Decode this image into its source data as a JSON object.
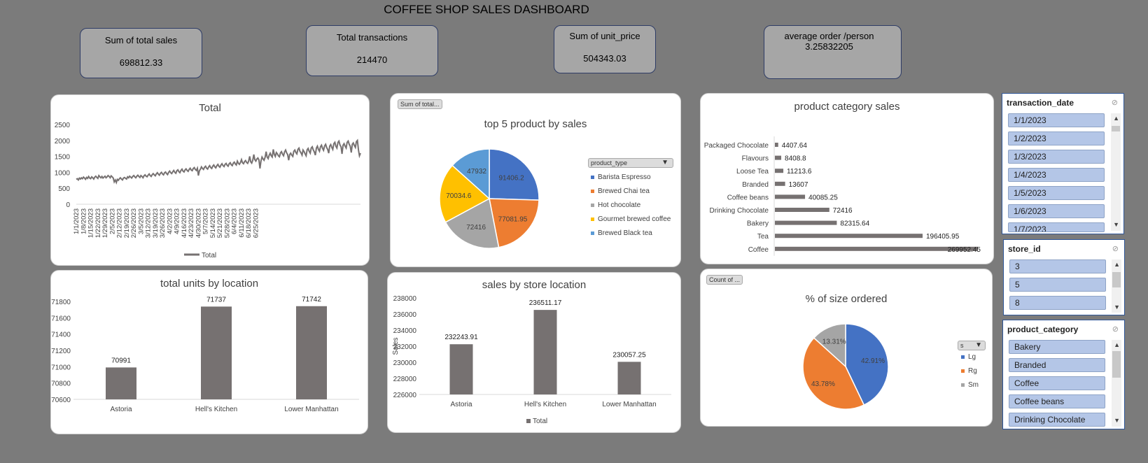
{
  "title": "COFFEE SHOP SALES DASHBOARD",
  "kpis": [
    {
      "label": "Sum of total sales",
      "value": "698812.33"
    },
    {
      "label": "Total transactions",
      "value": "214470"
    },
    {
      "label": "Sum of unit_price",
      "value": "504343.03"
    },
    {
      "label": "average order /person",
      "value": "3.25832205"
    }
  ],
  "colors": {
    "bar": "#767171",
    "line": "#767171",
    "blue": "#4472c4",
    "orange": "#ed7d31",
    "gray": "#a5a5a5",
    "yellow": "#ffc000",
    "lightblue": "#5b9bd5"
  },
  "chart_data": [
    {
      "type": "line",
      "title": "Total",
      "series": [
        {
          "name": "Total",
          "values": [
            780,
            800,
            760,
            820,
            790,
            830,
            800,
            850,
            820,
            780,
            840,
            810,
            870,
            820,
            800,
            860,
            830,
            790,
            850,
            880,
            840,
            810,
            900,
            860,
            830,
            870,
            820,
            850,
            880,
            830,
            860,
            900,
            870,
            830,
            890,
            860,
            820,
            700,
            760,
            680,
            780,
            750,
            800,
            830,
            790,
            760,
            820,
            840,
            810,
            790,
            860,
            830,
            880,
            850,
            820,
            870,
            900,
            860,
            830,
            880,
            910,
            870,
            840,
            900,
            870,
            830,
            890,
            920,
            880,
            860,
            910,
            950,
            900,
            870,
            930,
            960,
            920,
            890,
            950,
            990,
            940,
            910,
            970,
            1000,
            950,
            920,
            990,
            1010,
            960,
            930,
            1000,
            1040,
            990,
            960,
            1020,
            1060,
            1000,
            970,
            1050,
            1080,
            1020,
            990,
            1060,
            1100,
            1040,
            1010,
            1080,
            1110,
            1060,
            1030,
            1090,
            1130,
            1070,
            1050,
            1120,
            1150,
            1090,
            1060,
            1130,
            900,
            1050,
            1100,
            1170,
            1120,
            1090,
            1160,
            1190,
            1130,
            1100,
            1170,
            1210,
            1150,
            1120,
            1190,
            1230,
            1170,
            1140,
            1210,
            1250,
            1190,
            1160,
            1230,
            1270,
            1210,
            1180,
            1250,
            1280,
            1220,
            1190,
            1270,
            1300,
            1240,
            1210,
            1290,
            1320,
            1260,
            1230,
            1350,
            1280,
            1250,
            1310,
            1400,
            1300,
            1270,
            1340,
            1370,
            1310,
            1280,
            1350,
            1500,
            1330,
            1290,
            1380,
            1560,
            1400,
            1350,
            1420,
            1450,
            1390,
            1120,
            1350,
            1480,
            1420,
            1380,
            1470,
            1650,
            1480,
            1430,
            1540,
            1600,
            1520,
            1480,
            1720,
            1560,
            1500,
            1620,
            1580,
            1520,
            1490,
            1610,
            1650,
            1570,
            1520,
            1640,
            1700,
            1610,
            1560,
            1380,
            1560,
            1600,
            1540,
            1500,
            1660,
            1700,
            1620,
            1580,
            1720,
            1760,
            1660,
            1610,
            1540,
            1700,
            1650,
            1580,
            1520,
            1710,
            1750,
            1660,
            1600,
            1760,
            1800,
            1700,
            1640,
            1540,
            1760,
            1820,
            1720,
            1660,
            1800,
            1850,
            1750,
            1690,
            1830,
            1880,
            1780,
            1720,
            1600,
            1820,
            1870,
            1780,
            1720,
            1900,
            1940,
            1820,
            1760,
            1940,
            1980,
            1860,
            1800,
            1580,
            1850,
            1900,
            1820,
            1760,
            1940,
            1980,
            1880,
            1820,
            1620,
            1880,
            1920,
            1840,
            1780,
            1960,
            2000,
            1700,
            1520,
            1600
          ]
        }
      ],
      "x_ticks": [
        "1/1/2023",
        "1/8/2023",
        "1/15/2023",
        "1/22/2023",
        "1/29/2023",
        "2/5/2023",
        "2/12/2023",
        "2/19/2023",
        "2/26/2023",
        "3/5/2023",
        "3/12/2023",
        "3/19/2023",
        "3/26/2023",
        "4/2/2023",
        "4/9/2023",
        "4/16/2023",
        "4/23/2023",
        "4/30/2023",
        "5/7/2023",
        "5/14/2023",
        "5/21/2023",
        "5/28/2023",
        "6/4/2023",
        "6/11/2023",
        "6/18/2023",
        "6/25/2023"
      ],
      "ylim": [
        0,
        2500
      ],
      "y_ticks": [
        "0",
        "500",
        "1000",
        "1500",
        "2000",
        "2500"
      ],
      "legend": "Total"
    },
    {
      "type": "pie",
      "title": "top 5 product by sales",
      "field_button": "Sum of total...",
      "legend_title": "product_type",
      "slices": [
        {
          "name": "Barista Espresso",
          "value": 91406.2,
          "label": "91406.2"
        },
        {
          "name": "Brewed Chai tea",
          "value": 77081.95,
          "label": "77081.95"
        },
        {
          "name": "Hot chocolate",
          "value": 72416,
          "label": "72416"
        },
        {
          "name": "Gourmet brewed coffee",
          "value": 70034.6,
          "label": "70034.6"
        },
        {
          "name": "Brewed Black tea",
          "value": 47932,
          "label": "47932"
        }
      ]
    },
    {
      "type": "bar",
      "orientation": "horizontal",
      "title": "product category sales",
      "categories": [
        "Packaged Chocolate",
        "Flavours",
        "Loose Tea",
        "Branded",
        "Coffee beans",
        "Drinking Chocolate",
        "Bakery",
        "Tea",
        "Coffee"
      ],
      "values": [
        4407.64,
        8408.8,
        11213.6,
        13607,
        40085.25,
        72416,
        82315.64,
        196405.95,
        269952.45
      ],
      "labels": [
        "4407.64",
        "8408.8",
        "11213.6",
        "13607",
        "40085.25",
        "72416",
        "82315.64",
        "196405.95",
        "269952.45"
      ]
    },
    {
      "type": "bar",
      "title": "total units by location",
      "categories": [
        "Astoria",
        "Hell's Kitchen",
        "Lower Manhattan"
      ],
      "values": [
        70991,
        71737,
        71742
      ],
      "labels": [
        "70991",
        "71737",
        "71742"
      ],
      "ylim": [
        70600,
        71800
      ],
      "y_ticks": [
        "70600",
        "70800",
        "71000",
        "71200",
        "71400",
        "71600",
        "71800"
      ]
    },
    {
      "type": "bar",
      "title": "sales by store location",
      "ylabel": "Sales",
      "categories": [
        "Astoria",
        "Hell's Kitchen",
        "Lower Manhattan"
      ],
      "values": [
        232243.91,
        236511.17,
        230057.25
      ],
      "labels": [
        "232243.91",
        "236511.17",
        "230057.25"
      ],
      "ylim": [
        226000,
        238000
      ],
      "y_ticks": [
        "226000",
        "228000",
        "230000",
        "232000",
        "234000",
        "236000",
        "238000"
      ],
      "legend": "Total"
    },
    {
      "type": "pie",
      "title": "% of size ordered",
      "field_button": "Count of ...",
      "legend_title": "s",
      "slices": [
        {
          "name": "Lg",
          "value": 42.91,
          "label": "42.91%"
        },
        {
          "name": "Rg",
          "value": 43.78,
          "label": "43.78%"
        },
        {
          "name": "Sm",
          "value": 13.31,
          "label": "13.31%"
        }
      ]
    }
  ],
  "slicers": [
    {
      "title": "transaction_date",
      "items": [
        "1/1/2023",
        "1/2/2023",
        "1/3/2023",
        "1/4/2023",
        "1/5/2023",
        "1/6/2023",
        "1/7/2023"
      ]
    },
    {
      "title": "store_id",
      "items": [
        "3",
        "5",
        "8"
      ]
    },
    {
      "title": "product_category",
      "items": [
        "Bakery",
        "Branded",
        "Coffee",
        "Coffee beans",
        "Drinking Chocolate"
      ]
    }
  ]
}
